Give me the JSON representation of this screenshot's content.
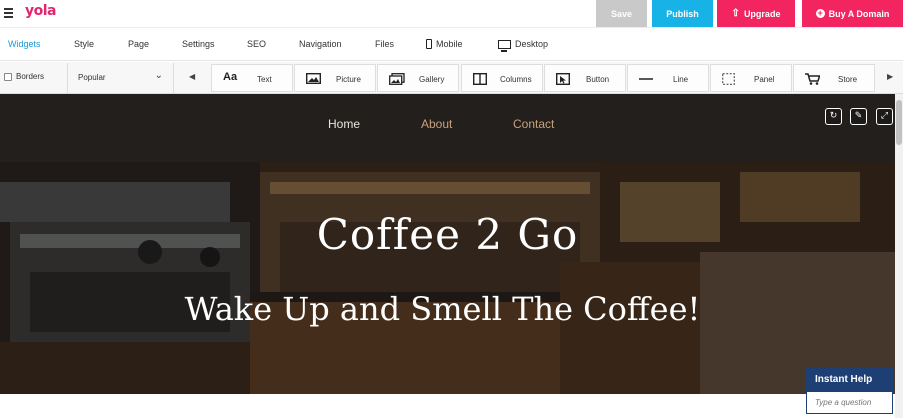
{
  "app": {
    "logo": "yola",
    "buttons": {
      "save": "Save",
      "publish": "Publish",
      "upgrade": "Upgrade",
      "buy_domain": "Buy A Domain"
    }
  },
  "tabs": [
    {
      "label": "Widgets",
      "active": true
    },
    {
      "label": "Style"
    },
    {
      "label": "Page"
    },
    {
      "label": "Settings"
    },
    {
      "label": "SEO"
    },
    {
      "label": "Navigation"
    },
    {
      "label": "Files"
    },
    {
      "label": "Mobile",
      "icon": "mobile-icon"
    },
    {
      "label": "Desktop",
      "icon": "desktop-icon"
    }
  ],
  "toolbar": {
    "borders_label": "Borders",
    "category_selected": "Popular",
    "widgets": [
      {
        "label": "Text",
        "icon": "text-icon"
      },
      {
        "label": "Picture",
        "icon": "picture-icon"
      },
      {
        "label": "Gallery",
        "icon": "gallery-icon"
      },
      {
        "label": "Columns",
        "icon": "columns-icon"
      },
      {
        "label": "Button",
        "icon": "button-icon"
      },
      {
        "label": "Line",
        "icon": "line-icon"
      },
      {
        "label": "Panel",
        "icon": "panel-icon"
      },
      {
        "label": "Store",
        "icon": "cart-icon"
      }
    ]
  },
  "site": {
    "nav": [
      "Home",
      "About",
      "Contact"
    ],
    "hero_title": "Coffee 2 Go",
    "hero_subtitle": "Wake Up and Smell The Coffee!"
  },
  "help": {
    "title": "Instant Help",
    "placeholder": "Type a question"
  },
  "colors": {
    "brand": "#e6236d",
    "publish": "#17b3e6",
    "upgrade": "#f32560",
    "active_tab": "#1a9ad6",
    "site_nav_bg": "#221f1c",
    "nav_link": "#c9a27a",
    "help_header": "#1e3f73"
  }
}
